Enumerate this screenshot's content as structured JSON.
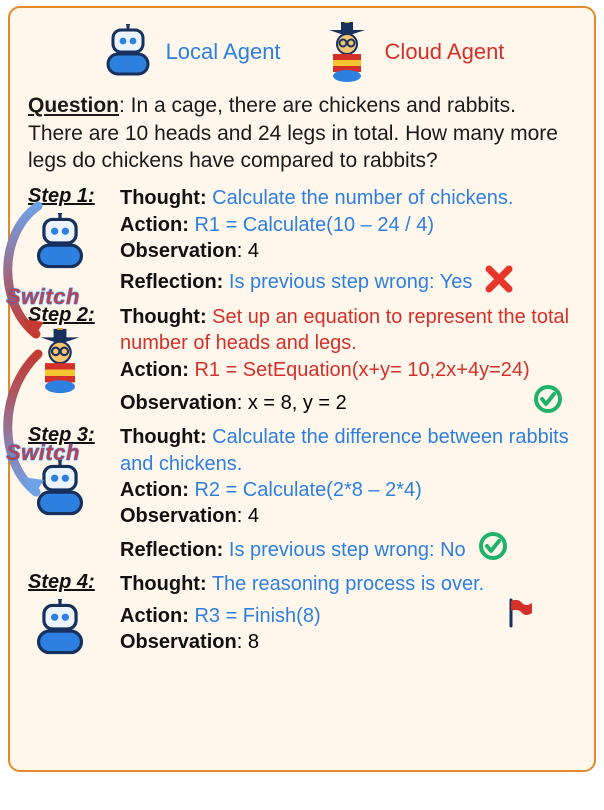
{
  "legend": {
    "local": "Local Agent",
    "cloud": "Cloud Agent"
  },
  "question": {
    "label": "Question",
    "text": ": In a cage, there are chickens and rabbits. There are 10 heads and 24 legs in total. How many more legs do chickens have compared to rabbits?"
  },
  "steps": {
    "s1": {
      "label": "Step 1:",
      "thought_kw": "Thought:",
      "thought": " Calculate the number of chickens.",
      "action_kw": "Action:",
      "action": " R1 = Calculate(10 – 24 / 4)",
      "obs_kw": "Observation",
      "obs": ": 4",
      "refl_kw": "Reflection:",
      "refl": " Is previous step wrong: Yes"
    },
    "s2": {
      "label": "Step 2:",
      "thought_kw": "Thought:",
      "thought": " Set up an equation to represent the total number of heads and legs.",
      "action_kw": "Action:",
      "action": " R1 = SetEquation(x+y= 10,2x+4y=24)",
      "obs_kw": "Observation",
      "obs": ": x = 8, y = 2"
    },
    "s3": {
      "label": "Step 3:",
      "thought_kw": "Thought:",
      "thought": " Calculate the difference between rabbits and chickens.",
      "action_kw": "Action:",
      "action": " R2 = Calculate(2*8 – 2*4)",
      "obs_kw": "Observation",
      "obs": ": 4",
      "refl_kw": "Reflection:",
      "refl": " Is previous step wrong: No"
    },
    "s4": {
      "label": "Step 4:",
      "thought_kw": "Thought:",
      "thought": " The reasoning process is over.",
      "action_kw": "Action:",
      "action": " R3 = Finish(8)",
      "obs_kw": "Observation",
      "obs": ": 8"
    }
  },
  "switch": "Switch"
}
